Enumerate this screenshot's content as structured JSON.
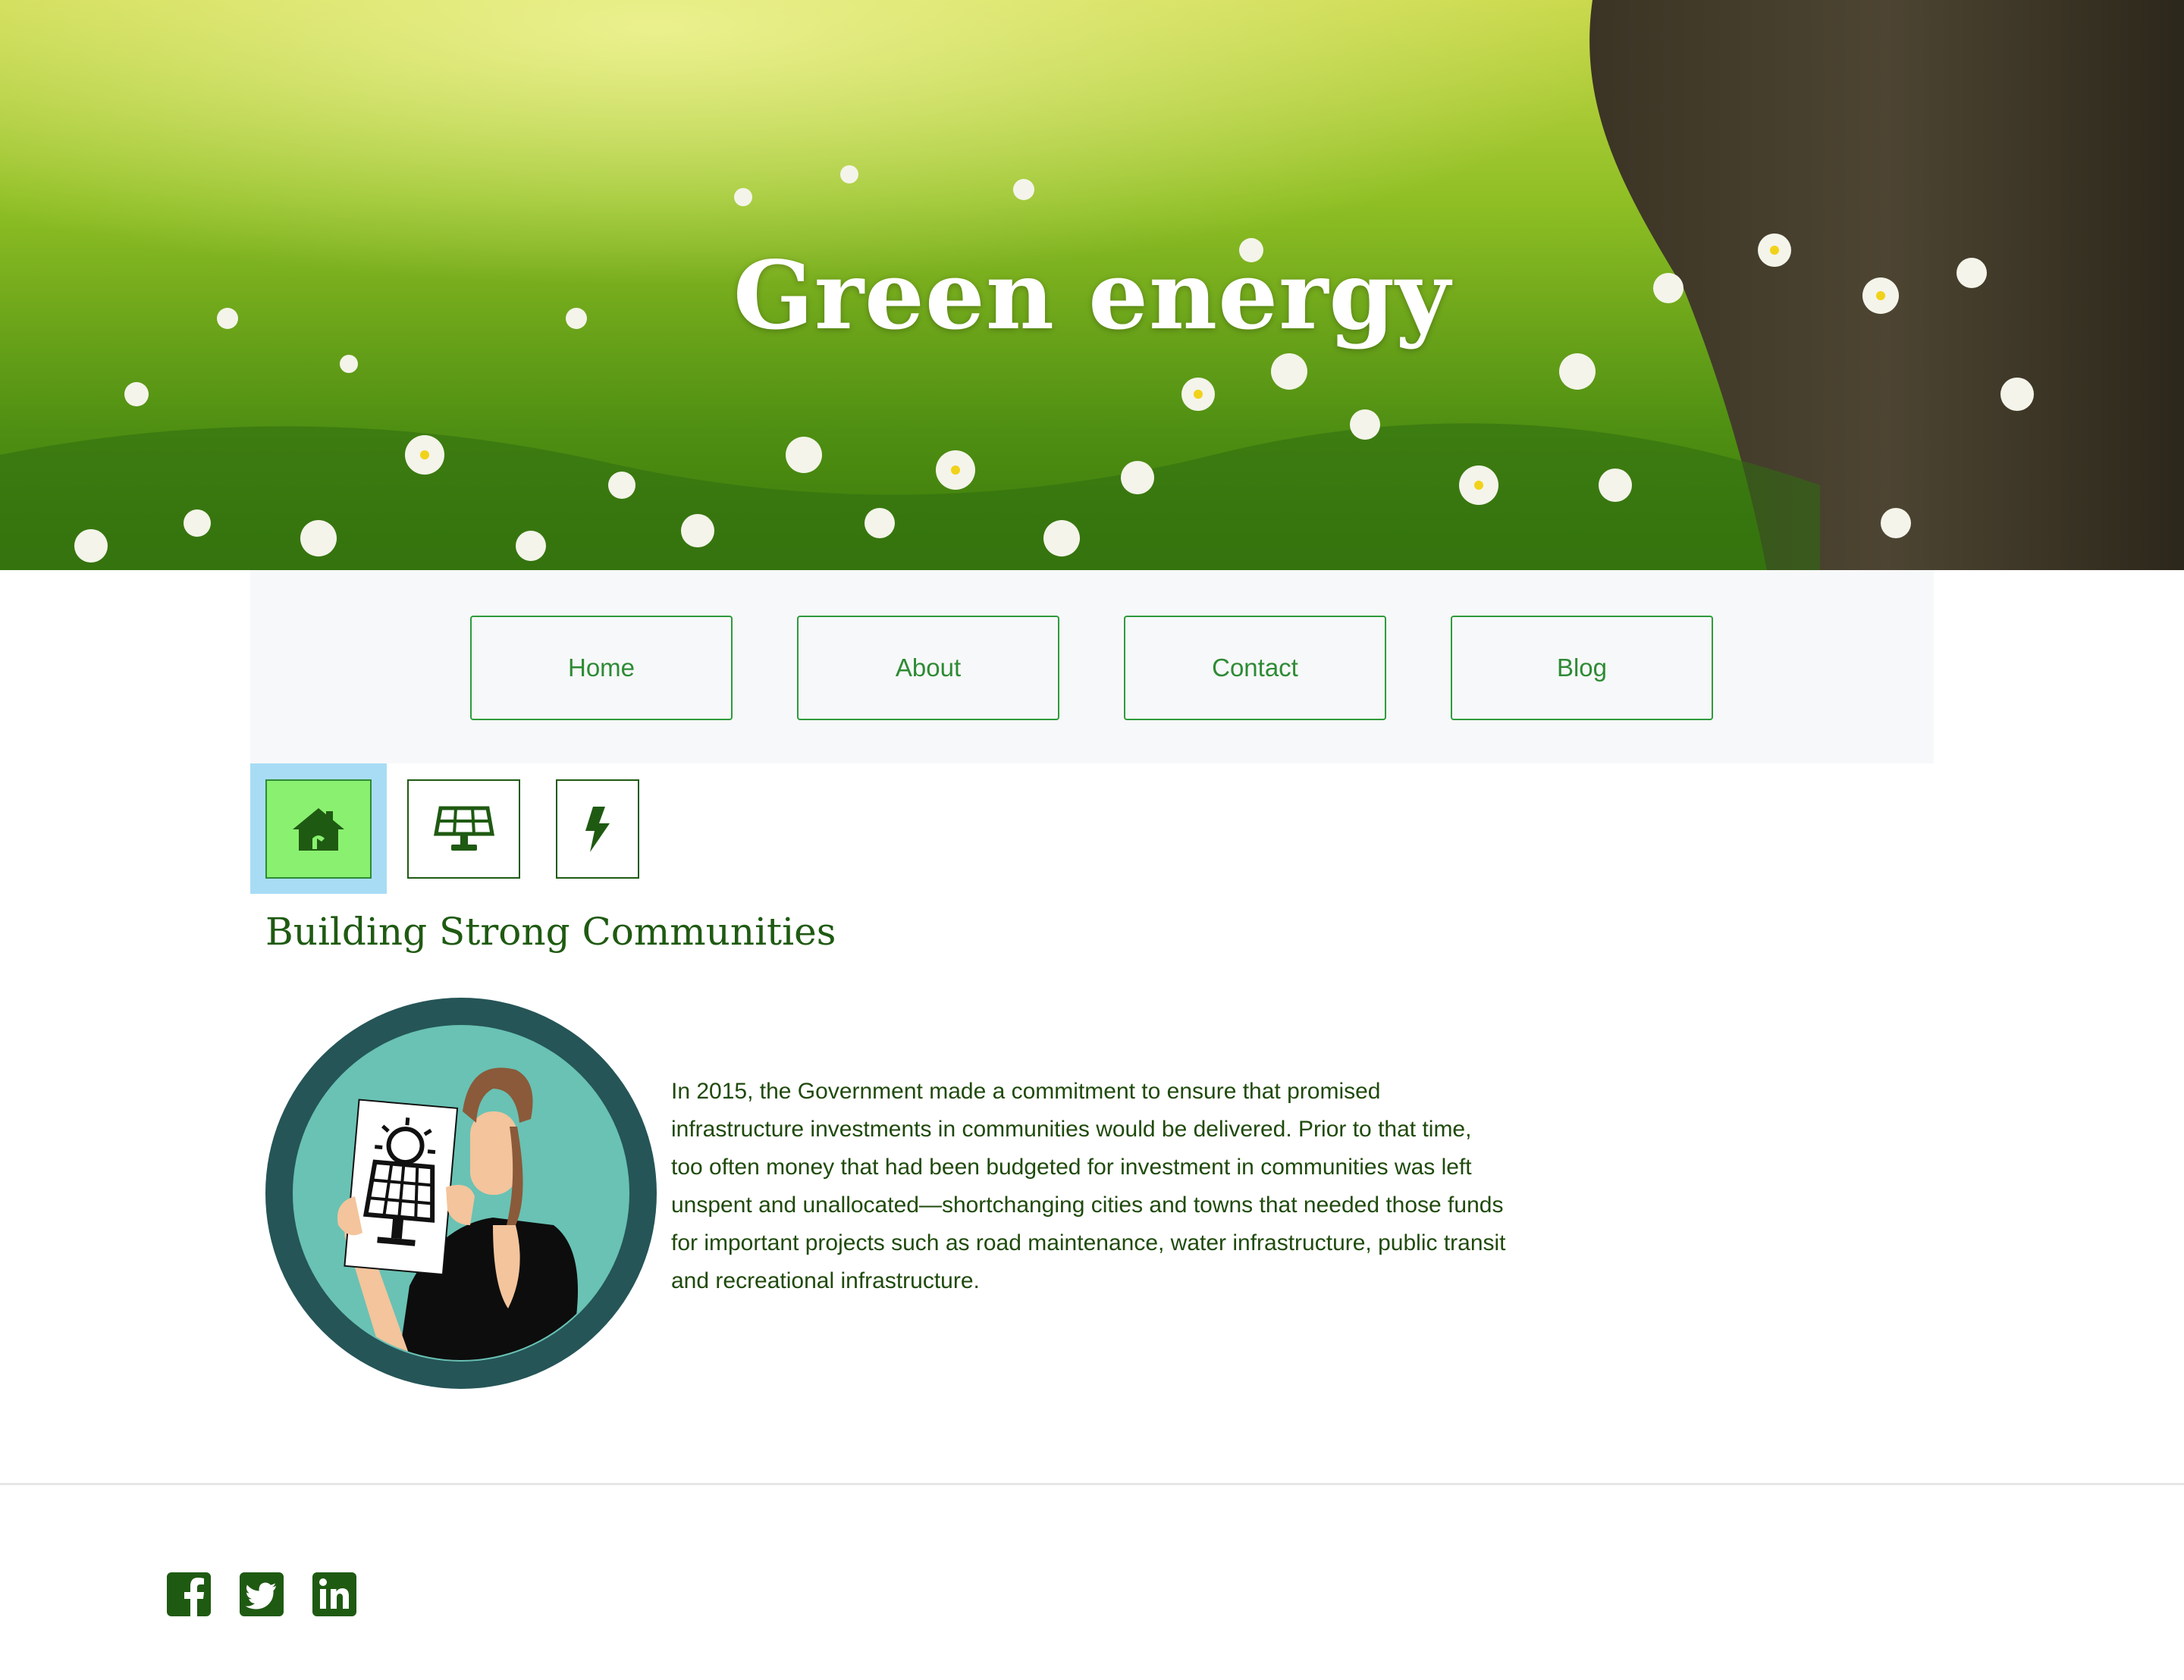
{
  "hero": {
    "title": "Green energy"
  },
  "nav": {
    "items": [
      "Home",
      "About",
      "Contact",
      "Blog"
    ]
  },
  "tabs": [
    {
      "icon": "home-icon",
      "active": true
    },
    {
      "icon": "solar-panel-icon",
      "active": false
    },
    {
      "icon": "lightning-bolt-icon",
      "active": false
    }
  ],
  "section": {
    "title": "Building Strong Communities",
    "paragraph_lines": [
      "In 2015, the Government made a commitment to ensure that promised",
      "infrastructure investments in communities would be delivered. Prior to that time,",
      "too often money that had been budgeted for investment in communities was left",
      "unspent and unallocated—shortchanging cities and towns that needed those funds",
      "for important projects such as road maintenance, water infrastructure, public transit",
      "and recreational infrastructure."
    ]
  },
  "footer": {
    "social": [
      "facebook-icon",
      "twitter-icon",
      "linkedin-icon"
    ]
  },
  "colors": {
    "accent": "#2e9b3c",
    "dark_green": "#1f5a12",
    "nav_bg": "#f7f8f9",
    "active_tab": "#8af070",
    "highlight": "#a8dcf5"
  }
}
